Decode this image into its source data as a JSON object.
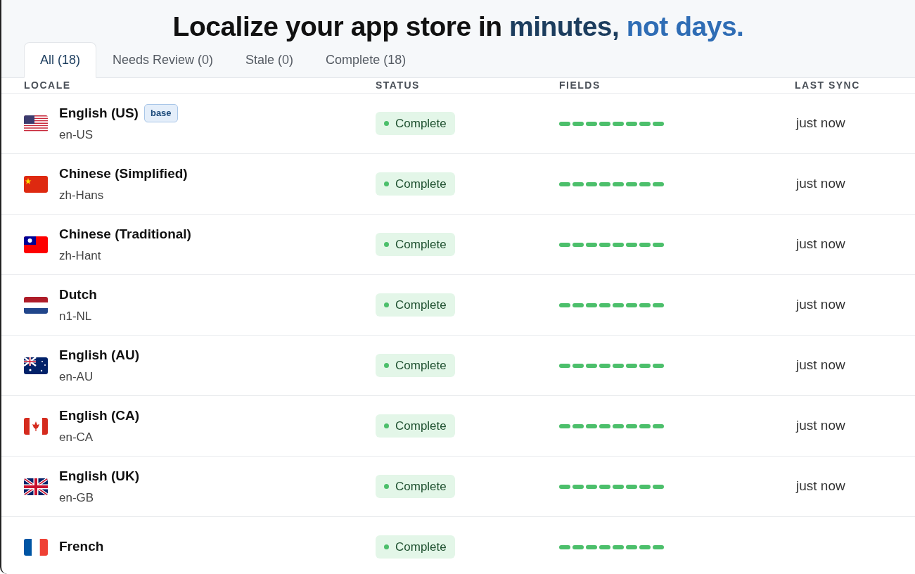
{
  "headline": [
    {
      "text": "Localize your app store in",
      "kind": "plain"
    },
    {
      "text": "minutes,",
      "kind": "dark-accent"
    },
    {
      "text": "not days.",
      "kind": "accent"
    }
  ],
  "tabs": [
    {
      "label": "All (18)",
      "selected": true
    },
    {
      "label": "Needs Review (0)",
      "selected": false
    },
    {
      "label": "Stale (0)",
      "selected": false
    },
    {
      "label": "Complete (18)",
      "selected": false
    }
  ],
  "table": {
    "columns": [
      "LOCALE",
      "STATUS",
      "FIELDS",
      "LAST SYNC"
    ],
    "rows": [
      {
        "name": "English (US)",
        "badge": "base",
        "code": "en-US",
        "status": "Complete",
        "fields": [
          {
            "done": true
          },
          {
            "done": true
          },
          {
            "done": true
          },
          {
            "done": true
          },
          {
            "done": true
          },
          {
            "done": true
          },
          {
            "done": true
          },
          {
            "done": true
          }
        ],
        "last_sync": "just now"
      },
      {
        "name": "Chinese (Simplified)",
        "code": "zh-Hans",
        "status": "Complete",
        "fields": [
          {
            "done": true
          },
          {
            "done": true
          },
          {
            "done": true
          },
          {
            "done": true
          },
          {
            "done": true
          },
          {
            "done": true
          },
          {
            "done": true
          },
          {
            "done": true
          }
        ],
        "last_sync": "just now"
      },
      {
        "name": "Chinese (Traditional)",
        "code": "zh-Hant",
        "status": "Complete",
        "fields": [
          {
            "done": true
          },
          {
            "done": true
          },
          {
            "done": true
          },
          {
            "done": true
          },
          {
            "done": true
          },
          {
            "done": true
          },
          {
            "done": true
          },
          {
            "done": true
          }
        ],
        "last_sync": "just now"
      },
      {
        "name": "Dutch",
        "code": "n1-NL",
        "status": "Complete",
        "fields": [
          {
            "done": true
          },
          {
            "done": true
          },
          {
            "done": true
          },
          {
            "done": true
          },
          {
            "done": true
          },
          {
            "done": true
          },
          {
            "done": true
          },
          {
            "done": true
          }
        ],
        "last_sync": "just now"
      },
      {
        "name": "English (AU)",
        "code": "en-AU",
        "status": "Complete",
        "fields": [
          {
            "done": true
          },
          {
            "done": true
          },
          {
            "done": true
          },
          {
            "done": true
          },
          {
            "done": true
          },
          {
            "done": true
          },
          {
            "done": true
          },
          {
            "done": true
          }
        ],
        "last_sync": "just now"
      },
      {
        "name": "English (CA)",
        "code": "en-CA",
        "status": "Complete",
        "fields": [
          {
            "done": true
          },
          {
            "done": true
          },
          {
            "done": true
          },
          {
            "done": true
          },
          {
            "done": true
          },
          {
            "done": true
          },
          {
            "done": true
          },
          {
            "done": true
          }
        ],
        "last_sync": "just now"
      },
      {
        "name": "English (UK)",
        "code": "en-GB",
        "status": "Complete",
        "fields": [
          {
            "done": true
          },
          {
            "done": true
          },
          {
            "done": true
          },
          {
            "done": true
          },
          {
            "done": true
          },
          {
            "done": true
          },
          {
            "done": true
          },
          {
            "done": true
          }
        ],
        "last_sync": "just now"
      },
      {
        "name": "French",
        "status": "Complete",
        "fields": [
          {
            "done": true
          },
          {
            "done": true
          },
          {
            "done": true
          },
          {
            "done": true
          },
          {
            "done": true
          },
          {
            "done": true
          },
          {
            "done": true
          },
          {
            "done": true
          }
        ]
      }
    ]
  }
}
